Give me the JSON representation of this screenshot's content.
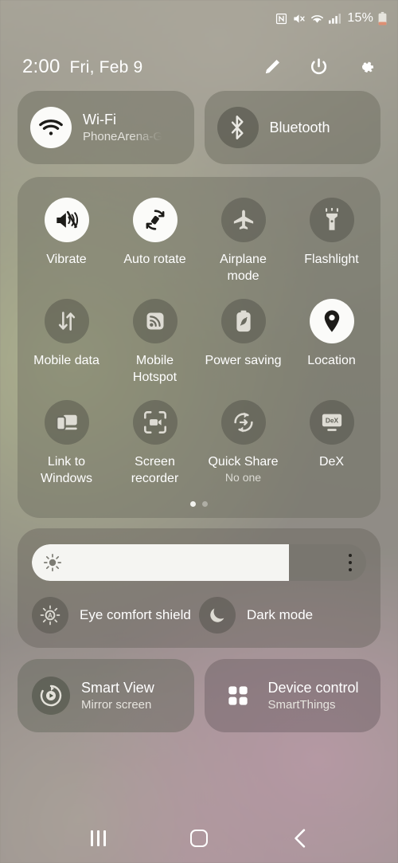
{
  "status_bar": {
    "icons": [
      "nfc-icon",
      "mute-icon",
      "wifi-icon",
      "signal-icon"
    ],
    "battery_percent": "15%"
  },
  "header": {
    "time": "2:00",
    "date": "Fri, Feb 9",
    "actions": [
      {
        "name": "edit-button",
        "icon": "pencil-icon"
      },
      {
        "name": "power-button",
        "icon": "power-icon"
      },
      {
        "name": "settings-button",
        "icon": "gear-icon"
      }
    ]
  },
  "connection_tiles": [
    {
      "title": "Wi-Fi",
      "subtitle": "PhoneArena-G",
      "icon": "wifi-icon",
      "state": "on"
    },
    {
      "title": "Bluetooth",
      "subtitle": "",
      "icon": "bluetooth-icon",
      "state": "off"
    }
  ],
  "toggles": {
    "rows": [
      [
        {
          "label": "Vibrate",
          "sub": "",
          "icon": "vibrate-icon",
          "state": "on"
        },
        {
          "label": "Auto rotate",
          "sub": "",
          "icon": "auto-rotate-icon",
          "state": "on"
        },
        {
          "label": "Airplane mode",
          "sub": "",
          "icon": "airplane-icon",
          "state": "off"
        },
        {
          "label": "Flashlight",
          "sub": "",
          "icon": "flashlight-icon",
          "state": "off"
        }
      ],
      [
        {
          "label": "Mobile data",
          "sub": "",
          "icon": "mobile-data-icon",
          "state": "off"
        },
        {
          "label": "Mobile Hotspot",
          "sub": "",
          "icon": "hotspot-icon",
          "state": "off"
        },
        {
          "label": "Power saving",
          "sub": "",
          "icon": "power-saving-icon",
          "state": "off"
        },
        {
          "label": "Location",
          "sub": "",
          "icon": "location-pin-icon",
          "state": "on"
        }
      ],
      [
        {
          "label": "Link to Windows",
          "sub": "",
          "icon": "link-to-windows-icon",
          "state": "off"
        },
        {
          "label": "Screen recorder",
          "sub": "",
          "icon": "screen-recorder-icon",
          "state": "off"
        },
        {
          "label": "Quick Share",
          "sub": "No one",
          "icon": "quick-share-icon",
          "state": "off"
        },
        {
          "label": "DeX",
          "sub": "",
          "icon": "dex-icon",
          "state": "off"
        }
      ]
    ],
    "page_count": 2,
    "active_page": 1
  },
  "brightness": {
    "icon": "brightness-sun-icon",
    "level_percent": 77,
    "menu_icon": "more-options-icon",
    "extras": [
      {
        "label": "Eye comfort shield",
        "icon": "eye-comfort-icon",
        "state": "off"
      },
      {
        "label": "Dark mode",
        "icon": "moon-icon",
        "state": "off"
      }
    ]
  },
  "bottom_tiles": [
    {
      "title": "Smart View",
      "subtitle": "Mirror screen",
      "icon": "smart-view-icon"
    },
    {
      "title": "Device control",
      "subtitle": "SmartThings",
      "icon": "grid-squares-icon"
    }
  ],
  "nav_bar": [
    {
      "name": "recents-button",
      "icon": "recents-icon"
    },
    {
      "name": "home-button",
      "icon": "home-icon"
    },
    {
      "name": "back-button",
      "icon": "back-chevron-icon"
    }
  ],
  "colors": {
    "accent_on": "#fbfbf9",
    "icon_dark": "#24231f",
    "text": "#ffffff"
  }
}
